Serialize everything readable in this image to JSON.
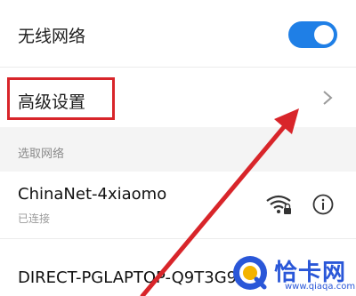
{
  "wlan": {
    "label": "无线网络",
    "enabled": true,
    "toggle_color": "#1f7fe6"
  },
  "advanced": {
    "label": "高级设置",
    "highlight_color": "#d8252a"
  },
  "section": {
    "title": "选取网络"
  },
  "networks": [
    {
      "ssid": "ChinaNet-4xiaomo",
      "status": "已连接",
      "icons": [
        "wifi-locked-icon",
        "info-icon"
      ]
    },
    {
      "ssid": "DIRECT-PGLAPTOP-Q9T3G9"
    }
  ],
  "watermark": {
    "name": "恰卡网",
    "url": "www.qiaqa.com"
  },
  "colors": {
    "arrow": "#d8252a",
    "watermark": "#2a57d8"
  }
}
